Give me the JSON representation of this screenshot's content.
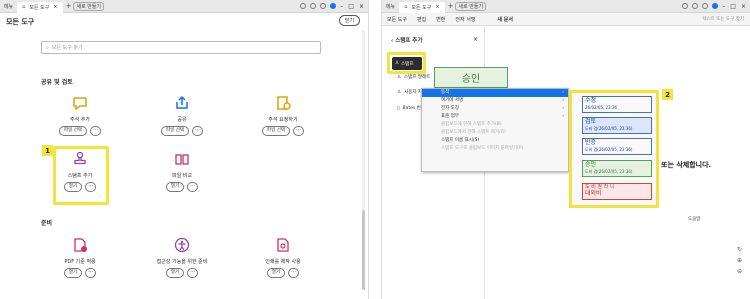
{
  "left": {
    "tabs": {
      "menu": "메뉴",
      "active_tab": "모든 도구",
      "new": "새로 만들기"
    },
    "page_title": "모든 도구",
    "close_label": "닫기",
    "search_placeholder": "모든 도구 찾기",
    "section1": "공유 및 검토",
    "section2": "준비",
    "tools_row1": [
      {
        "name": "주석 추가",
        "btn": "파일 선택"
      },
      {
        "name": "공유",
        "btn": "파일 선택"
      },
      {
        "name": "주석 요청하기",
        "btn": "파일 선택"
      }
    ],
    "tools_row2": [
      {
        "name": "스탬프 추가",
        "btn": "열기"
      },
      {
        "name": "파일 비교",
        "btn": "열기"
      }
    ],
    "tools_row3": [
      {
        "name": "PDF 기준 적용",
        "btn": "열기"
      },
      {
        "name": "접근성 기능을 위한 준비",
        "btn": "열기"
      },
      {
        "name": "인쇄를 제작 사용",
        "btn": "열기"
      }
    ],
    "callout": "1",
    "colors": {
      "callout": "#f1e43d",
      "accent": "#1473e6"
    }
  },
  "right": {
    "tabs": {
      "menu": "메뉴",
      "active_tab": "모든 도구",
      "new": "새로 만들기"
    },
    "menubar": [
      "모든 도구",
      "편집",
      "변환",
      "전자 서명"
    ],
    "doc_title": "새 문서",
    "search_hint": "텍스트 또는 도구 찾기",
    "panel": {
      "title": "스탬프 추가",
      "stamp_btn": "스탬프",
      "items": [
        "스탬프 팔레트",
        "사용자 지정",
        "Bates 번호"
      ]
    },
    "stamp_preview": "승인",
    "context_menu": [
      {
        "label": "동적",
        "selected": true,
        "arrow": "›"
      },
      {
        "label": "여기에 서명",
        "arrow": "›"
      },
      {
        "label": "전자 도장",
        "arrow": "›"
      },
      {
        "label": "표준 업무",
        "arrow": "›"
      },
      {
        "label": "클립보드에 한해 스탬프 추가(B)",
        "disabled": true
      },
      {
        "label": "클립보드에서 한해 스탬프 제거(R)",
        "disabled": true
      },
      {
        "label": "스탬프 이름 표시(S)"
      },
      {
        "label": "스탬프 도구로 클립보드 이미지 붙여넣기(P)",
        "disabled": true
      }
    ],
    "stamps": [
      {
        "title": "수정",
        "sub": "26/02/05, 23:36",
        "style": "blue"
      },
      {
        "title": "검토",
        "sub": "도비 검(26/02/05, 23:36)",
        "style": "blue-sel"
      },
      {
        "title": "반증",
        "sub": "도비 검(26/02/05, 23:36)",
        "style": "blue"
      },
      {
        "title": "승인",
        "sub": "도비 검(26/02/05, 23:36)",
        "style": "green"
      },
      {
        "title": "도 비 권 라 니",
        "sub": "대외비",
        "style": "red"
      }
    ],
    "hint_text": "또는 삭제합니다.",
    "doc_caption": "도움말",
    "callout": "2"
  }
}
